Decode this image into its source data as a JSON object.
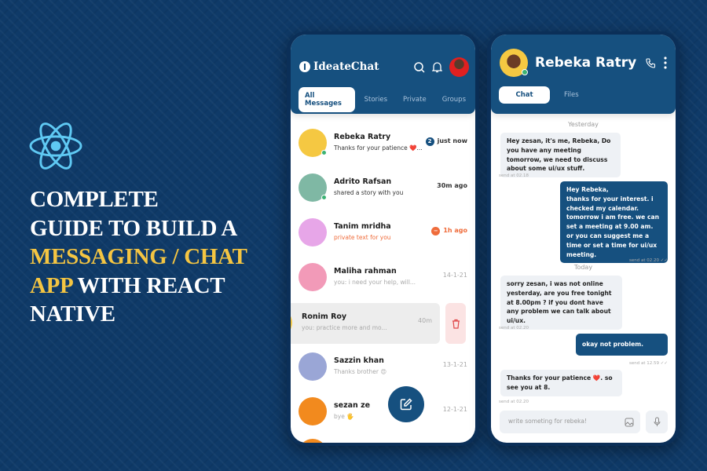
{
  "headline": {
    "line1": "COMPLETE",
    "line2": "GUIDE TO BUILD A",
    "line3": "MESSAGING / CHAT",
    "line4_highlight": "APP",
    "line4_rest": " WITH REACT",
    "line5": "NATIVE"
  },
  "colors": {
    "background": "#0f3a68",
    "primary": "#16507f",
    "highlight": "#f4c542",
    "react": "#5fc9f3",
    "accent_red": "#ef6c3b",
    "online": "#3bb273"
  },
  "list_screen": {
    "app_name": "IdeateChat",
    "tabs": [
      {
        "label": "All Messages",
        "active": true
      },
      {
        "label": "Stories"
      },
      {
        "label": "Private"
      },
      {
        "label": "Groups"
      }
    ],
    "chats": [
      {
        "name": "Rebeka Ratry",
        "preview": "Thanks for your patience ❤️...",
        "time": "just now",
        "badge": "2",
        "online": true,
        "avatar_color": "#f5c842"
      },
      {
        "name": "Adrito Rafsan",
        "preview": "shared a story with you",
        "time": "30m ago",
        "online": true,
        "avatar_color": "#7fb8a4"
      },
      {
        "name": "Tanim mridha",
        "preview": "private text for you",
        "time": "1h ago",
        "private": true,
        "avatar_color": "#e7a6e8"
      },
      {
        "name": "Maliha rahman",
        "preview": "you: i need your help, will...",
        "time": "14-1-21",
        "avatar_color": "#f29ab8"
      },
      {
        "name": "Ronim Roy",
        "preview": "you: practice more and mo...",
        "time": "40m",
        "swiped": true,
        "avatar_color": "#f5c842"
      },
      {
        "name": "Sazzin khan",
        "preview": "Thanks brother 😍",
        "time": "13-1-21",
        "avatar_color": "#9aa6d6"
      },
      {
        "name": "sezan ze",
        "preview": "bye 🖐",
        "time": "12-1-21",
        "avatar_color": "#f28a1e"
      }
    ]
  },
  "chat_screen": {
    "contact_name": "Rebeka Ratry",
    "tabs": [
      {
        "label": "Chat",
        "active": true
      },
      {
        "label": "Files"
      }
    ],
    "day1": "Yesterday",
    "day2": "Today",
    "messages": [
      {
        "dir": "in",
        "text": "Hey zesan, it's me, Rebeka, Do you have any meeting tomorrow, we need to discuss about some ui/ux stuff.",
        "stamp": "send at 02.18"
      },
      {
        "dir": "out",
        "text": "Hey Rebeka,\nthanks for your interest. i checked my calendar. tomorrow i am free. we can set a meeting at 9.00 am. or you can suggest me a time or set a time for ui/ux meeting.",
        "stamp": "send at 02.20 ✓✓"
      },
      {
        "dir": "in",
        "text": "sorry zesan, i was not online yesterday, are you free tonight at 8.00pm ? if you dont have any problem we can talk about ui/ux.",
        "stamp": "send at 02.20"
      },
      {
        "dir": "out",
        "text": "okay not problem.",
        "stamp": "send at 12.59 ✓✓"
      },
      {
        "dir": "in",
        "text": "Thanks for your patience ❤️. so see you at 8.",
        "stamp": "send at 02.20"
      }
    ],
    "input_placeholder": "write someting for rebeka!"
  }
}
